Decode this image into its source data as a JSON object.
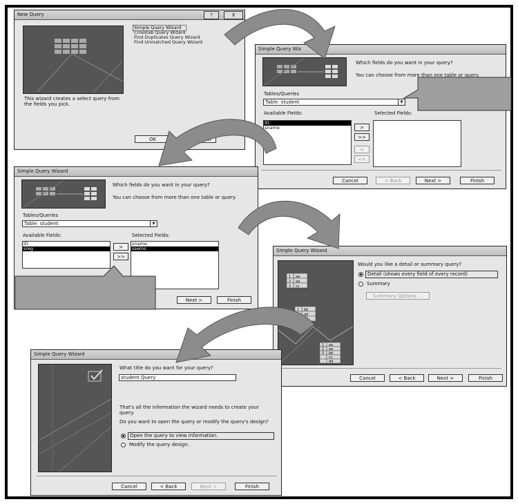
{
  "new_query": {
    "title": "New Query",
    "help": "?",
    "close": "X",
    "options": [
      "Simple Query Wizard",
      "Crosstab Query Wizard",
      "Find Duplicates Query Wizard",
      "Find Unmatched Query Wizard"
    ],
    "description": "This wizard creates a select query from the fields you pick.",
    "ok": "OK",
    "cancel": "ancel"
  },
  "wizard1": {
    "title": "Simple Query Wiz",
    "question": "Which fields do you want in your query?",
    "hint": "You can choose from more than one table or query.",
    "tables_label": "Tables/Queries",
    "table_value": "Table: student",
    "available_label": "Available Fields:",
    "selected_label": "Selected Fields:",
    "available": [
      "ID",
      "sname"
    ],
    "move_one": ">",
    "move_all": ">>",
    "back_one": "<",
    "back_all": "<<",
    "cancel": "Cancel",
    "back": "< Back",
    "next": "Next >",
    "finish": "Finish"
  },
  "wizard2": {
    "title": "Simple Query Wizard",
    "question": "Which fields do you want in your query?",
    "hint": "You can choose from more than one table or query.",
    "tables_label": "Tables/Queries",
    "table_value": "Table: student",
    "available_label": "Available Fields:",
    "selected_label": "Selected Fields:",
    "available": [
      "ID",
      "sreg"
    ],
    "selected": [
      "sname",
      "ssems"
    ],
    "move_one": ">",
    "move_all": ">>",
    "next": "Next >",
    "finish": "Finish"
  },
  "wizard3": {
    "title": "Simple Query Wizard",
    "question": "Would you like a detail or summary query?",
    "detail": "Detail (shows every field of every record)",
    "summary": "Summary",
    "summary_options": "Summary Options ...",
    "thumb_rows_top": [
      [
        "1",
        "aa"
      ],
      [
        "2",
        "aa"
      ],
      [
        "3",
        "cc"
      ]
    ],
    "thumb_rows_mid": [
      [
        "1",
        "bb"
      ],
      [
        "2",
        "dd"
      ],
      [
        "3",
        "dd"
      ]
    ],
    "thumb_rows_bot": [
      [
        "1",
        "aa"
      ],
      [
        "2",
        "aa"
      ],
      [
        "3",
        "bb"
      ],
      [
        "",
        "cc"
      ],
      [
        "",
        "dd"
      ],
      [
        "",
        "dd"
      ]
    ],
    "cancel": "Cancel",
    "back": "< Back",
    "next": "Next >",
    "finish": "Finish"
  },
  "wizard4": {
    "title": "Simple Query Wizard",
    "question": "What title do you want for your query?",
    "title_value": "student Query",
    "info": "That's all the information the wizard needs to create your query.",
    "ask": "Do you want to open the query or modify the query's design?",
    "open": "Open the query to view information.",
    "modify": "Modify the query design.",
    "cancel": "Cancel",
    "back": "< Back",
    "next": "Next >",
    "finish": "Finish"
  },
  "colors": {
    "arrow": "#8a8a8a",
    "callout": "#9a9a9a",
    "thumb": "#555555"
  }
}
